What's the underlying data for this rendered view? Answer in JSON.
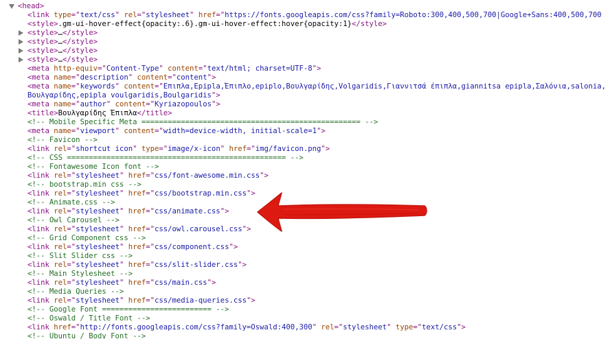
{
  "colors": {
    "tag": "#881280",
    "attribute_name": "#994500",
    "attribute_value": "#1a1aa6",
    "text": "#000000",
    "comment": "#236e25",
    "toggle_arrow": "#7a7a7a",
    "annotation_arrow": "#dd1a12"
  },
  "annotation": {
    "icon": "red-hand-drawn-arrow-icon",
    "points_to_line": 11
  },
  "lines": [
    {
      "indent": 0,
      "toggle": "open",
      "tokens": [
        [
          "tag",
          "<head>"
        ]
      ]
    },
    {
      "indent": 1,
      "tokens": [
        [
          "tag",
          "<link "
        ],
        [
          "attr",
          "type"
        ],
        [
          "tag",
          "=\""
        ],
        [
          "val",
          "text/css"
        ],
        [
          "tag",
          "\" "
        ],
        [
          "attr",
          "rel"
        ],
        [
          "tag",
          "=\""
        ],
        [
          "val",
          "stylesheet"
        ],
        [
          "tag",
          "\" "
        ],
        [
          "attr",
          "href"
        ],
        [
          "tag",
          "=\""
        ],
        [
          "val",
          "https://fonts.googleapis.com/css?family=Roboto:300,400,500,700|Google+Sans:400,500,700"
        ]
      ]
    },
    {
      "indent": 1,
      "tokens": [
        [
          "tag",
          "<style>"
        ],
        [
          "text",
          ".gm-ui-hover-effect{opacity:.6}.gm-ui-hover-effect:hover{opacity:1}"
        ],
        [
          "tag",
          "</style>"
        ]
      ]
    },
    {
      "indent": 1,
      "toggle": "closed",
      "tokens": [
        [
          "tag",
          "<style>"
        ],
        [
          "text",
          "…"
        ],
        [
          "tag",
          "</style>"
        ]
      ]
    },
    {
      "indent": 1,
      "toggle": "closed",
      "tokens": [
        [
          "tag",
          "<style>"
        ],
        [
          "text",
          "…"
        ],
        [
          "tag",
          "</style>"
        ]
      ]
    },
    {
      "indent": 1,
      "toggle": "closed",
      "tokens": [
        [
          "tag",
          "<style>"
        ],
        [
          "text",
          "…"
        ],
        [
          "tag",
          "</style>"
        ]
      ]
    },
    {
      "indent": 1,
      "toggle": "closed",
      "tokens": [
        [
          "tag",
          "<style>"
        ],
        [
          "text",
          "…"
        ],
        [
          "tag",
          "</style>"
        ]
      ]
    },
    {
      "indent": 1,
      "tokens": [
        [
          "tag",
          "<meta "
        ],
        [
          "attr",
          "http-equiv"
        ],
        [
          "tag",
          "=\""
        ],
        [
          "val",
          "Content-Type"
        ],
        [
          "tag",
          "\" "
        ],
        [
          "attr",
          "content"
        ],
        [
          "tag",
          "=\""
        ],
        [
          "val",
          "text/html; charset=UTF-8"
        ],
        [
          "tag",
          "\">"
        ]
      ]
    },
    {
      "indent": 1,
      "tokens": [
        [
          "tag",
          "<meta "
        ],
        [
          "attr",
          "name"
        ],
        [
          "tag",
          "=\""
        ],
        [
          "val",
          "description"
        ],
        [
          "tag",
          "\" "
        ],
        [
          "attr",
          "content"
        ],
        [
          "tag",
          "=\""
        ],
        [
          "val",
          "content"
        ],
        [
          "tag",
          "\">"
        ]
      ]
    },
    {
      "indent": 1,
      "tokens": [
        [
          "tag",
          "<meta "
        ],
        [
          "attr",
          "name"
        ],
        [
          "tag",
          "=\""
        ],
        [
          "val",
          "keywords"
        ],
        [
          "tag",
          "\" "
        ],
        [
          "attr",
          "content"
        ],
        [
          "tag",
          "=\""
        ],
        [
          "val",
          "Επιπλα,Epipla,Έπιπλο,epiplo,Βουλγαρίδης,Volgaridis,Γιαννιτσά έπιπλα,giannitsa epipla,Σαλόνια,salonia,"
        ]
      ]
    },
    {
      "indent": 1,
      "tokens": [
        [
          "val",
          "Βουλγαρίδης,epipla voulgaridis,Boulgaridis"
        ],
        [
          "tag",
          "\">"
        ]
      ]
    },
    {
      "indent": 1,
      "tokens": [
        [
          "tag",
          "<meta "
        ],
        [
          "attr",
          "name"
        ],
        [
          "tag",
          "=\""
        ],
        [
          "val",
          "author"
        ],
        [
          "tag",
          "\" "
        ],
        [
          "attr",
          "content"
        ],
        [
          "tag",
          "=\""
        ],
        [
          "val",
          "Kyriazopoulos"
        ],
        [
          "tag",
          "\">"
        ]
      ]
    },
    {
      "indent": 1,
      "tokens": [
        [
          "tag",
          "<title>"
        ],
        [
          "text",
          "Βουλγαρίδης Έπιπλα"
        ],
        [
          "tag",
          "</title>"
        ]
      ]
    },
    {
      "indent": 1,
      "tokens": [
        [
          "comment",
          "<!-- Mobile Specific Meta ================================================== -->"
        ]
      ]
    },
    {
      "indent": 1,
      "tokens": [
        [
          "tag",
          "<meta "
        ],
        [
          "attr",
          "name"
        ],
        [
          "tag",
          "=\""
        ],
        [
          "val",
          "viewport"
        ],
        [
          "tag",
          "\" "
        ],
        [
          "attr",
          "content"
        ],
        [
          "tag",
          "=\""
        ],
        [
          "val",
          "width=device-width, initial-scale=1"
        ],
        [
          "tag",
          "\">"
        ]
      ]
    },
    {
      "indent": 1,
      "tokens": [
        [
          "comment",
          "<!-- Favicon -->"
        ]
      ]
    },
    {
      "indent": 1,
      "tokens": [
        [
          "tag",
          "<link "
        ],
        [
          "attr",
          "rel"
        ],
        [
          "tag",
          "=\""
        ],
        [
          "val",
          "shortcut icon"
        ],
        [
          "tag",
          "\" "
        ],
        [
          "attr",
          "type"
        ],
        [
          "tag",
          "=\""
        ],
        [
          "val",
          "image/x-icon"
        ],
        [
          "tag",
          "\" "
        ],
        [
          "attr",
          "href"
        ],
        [
          "tag",
          "=\""
        ],
        [
          "val",
          "img/favicon.png"
        ],
        [
          "tag",
          "\">"
        ]
      ]
    },
    {
      "indent": 1,
      "tokens": [
        [
          "comment",
          "<!-- CSS ================================================== -->"
        ]
      ]
    },
    {
      "indent": 1,
      "tokens": [
        [
          "comment",
          "<!-- Fontawesome Icon font -->"
        ]
      ]
    },
    {
      "indent": 1,
      "tokens": [
        [
          "tag",
          "<link "
        ],
        [
          "attr",
          "rel"
        ],
        [
          "tag",
          "=\""
        ],
        [
          "val",
          "stylesheet"
        ],
        [
          "tag",
          "\" "
        ],
        [
          "attr",
          "href"
        ],
        [
          "tag",
          "=\""
        ],
        [
          "val",
          "css/font-awesome.min.css"
        ],
        [
          "tag",
          "\">"
        ]
      ]
    },
    {
      "indent": 1,
      "tokens": [
        [
          "comment",
          "<!-- bootstrap.min css -->"
        ]
      ]
    },
    {
      "indent": 1,
      "tokens": [
        [
          "tag",
          "<link "
        ],
        [
          "attr",
          "rel"
        ],
        [
          "tag",
          "=\""
        ],
        [
          "val",
          "stylesheet"
        ],
        [
          "tag",
          "\" "
        ],
        [
          "attr",
          "href"
        ],
        [
          "tag",
          "=\""
        ],
        [
          "val",
          "css/bootstrap.min.css"
        ],
        [
          "tag",
          "\">"
        ]
      ]
    },
    {
      "indent": 1,
      "tokens": [
        [
          "comment",
          "<!-- Animate.css -->"
        ]
      ]
    },
    {
      "indent": 1,
      "tokens": [
        [
          "tag",
          "<link "
        ],
        [
          "attr",
          "rel"
        ],
        [
          "tag",
          "=\""
        ],
        [
          "val",
          "stylesheet"
        ],
        [
          "tag",
          "\" "
        ],
        [
          "attr",
          "href"
        ],
        [
          "tag",
          "=\""
        ],
        [
          "val",
          "css/animate.css"
        ],
        [
          "tag",
          "\">"
        ]
      ]
    },
    {
      "indent": 1,
      "tokens": [
        [
          "comment",
          "<!-- Owl Carousel -->"
        ]
      ]
    },
    {
      "indent": 1,
      "tokens": [
        [
          "tag",
          "<link "
        ],
        [
          "attr",
          "rel"
        ],
        [
          "tag",
          "=\""
        ],
        [
          "val",
          "stylesheet"
        ],
        [
          "tag",
          "\" "
        ],
        [
          "attr",
          "href"
        ],
        [
          "tag",
          "=\""
        ],
        [
          "val",
          "css/owl.carousel.css"
        ],
        [
          "tag",
          "\">"
        ]
      ]
    },
    {
      "indent": 1,
      "tokens": [
        [
          "comment",
          "<!-- Grid Component css -->"
        ]
      ]
    },
    {
      "indent": 1,
      "tokens": [
        [
          "tag",
          "<link "
        ],
        [
          "attr",
          "rel"
        ],
        [
          "tag",
          "=\""
        ],
        [
          "val",
          "stylesheet"
        ],
        [
          "tag",
          "\" "
        ],
        [
          "attr",
          "href"
        ],
        [
          "tag",
          "=\""
        ],
        [
          "val",
          "css/component.css"
        ],
        [
          "tag",
          "\">"
        ]
      ]
    },
    {
      "indent": 1,
      "tokens": [
        [
          "comment",
          "<!-- Slit Slider css -->"
        ]
      ]
    },
    {
      "indent": 1,
      "tokens": [
        [
          "tag",
          "<link "
        ],
        [
          "attr",
          "rel"
        ],
        [
          "tag",
          "=\""
        ],
        [
          "val",
          "stylesheet"
        ],
        [
          "tag",
          "\" "
        ],
        [
          "attr",
          "href"
        ],
        [
          "tag",
          "=\""
        ],
        [
          "val",
          "css/slit-slider.css"
        ],
        [
          "tag",
          "\">"
        ]
      ]
    },
    {
      "indent": 1,
      "tokens": [
        [
          "comment",
          "<!-- Main Stylesheet -->"
        ]
      ]
    },
    {
      "indent": 1,
      "tokens": [
        [
          "tag",
          "<link "
        ],
        [
          "attr",
          "rel"
        ],
        [
          "tag",
          "=\""
        ],
        [
          "val",
          "stylesheet"
        ],
        [
          "tag",
          "\" "
        ],
        [
          "attr",
          "href"
        ],
        [
          "tag",
          "=\""
        ],
        [
          "val",
          "css/main.css"
        ],
        [
          "tag",
          "\">"
        ]
      ]
    },
    {
      "indent": 1,
      "tokens": [
        [
          "comment",
          "<!-- Media Queries -->"
        ]
      ]
    },
    {
      "indent": 1,
      "tokens": [
        [
          "tag",
          "<link "
        ],
        [
          "attr",
          "rel"
        ],
        [
          "tag",
          "=\""
        ],
        [
          "val",
          "stylesheet"
        ],
        [
          "tag",
          "\" "
        ],
        [
          "attr",
          "href"
        ],
        [
          "tag",
          "=\""
        ],
        [
          "val",
          "css/media-queries.css"
        ],
        [
          "tag",
          "\">"
        ]
      ]
    },
    {
      "indent": 1,
      "tokens": [
        [
          "comment",
          "<!-- Google Font ========================= -->"
        ]
      ]
    },
    {
      "indent": 1,
      "tokens": [
        [
          "comment",
          "<!-- Oswald / Title Font -->"
        ]
      ]
    },
    {
      "indent": 1,
      "tokens": [
        [
          "tag",
          "<link "
        ],
        [
          "attr",
          "href"
        ],
        [
          "tag",
          "=\""
        ],
        [
          "val",
          "http://fonts.googleapis.com/css?family=Oswald:400,300"
        ],
        [
          "tag",
          "\" "
        ],
        [
          "attr",
          "rel"
        ],
        [
          "tag",
          "=\""
        ],
        [
          "val",
          "stylesheet"
        ],
        [
          "tag",
          "\" "
        ],
        [
          "attr",
          "type"
        ],
        [
          "tag",
          "=\""
        ],
        [
          "val",
          "text/css"
        ],
        [
          "tag",
          "\">"
        ]
      ]
    },
    {
      "indent": 1,
      "tokens": [
        [
          "comment",
          "<!-- Ubuntu / Body Font -->"
        ]
      ]
    }
  ]
}
